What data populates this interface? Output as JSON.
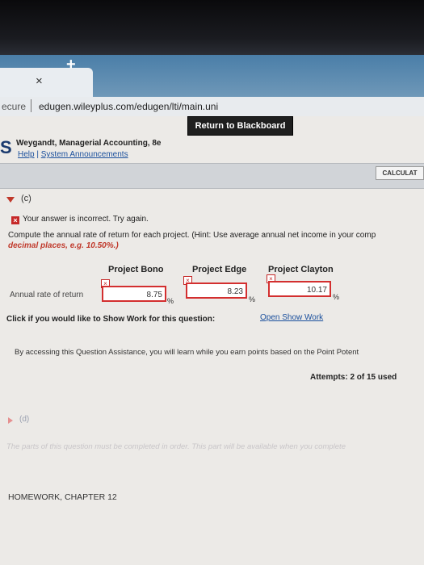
{
  "browser": {
    "tab_close_glyph": "×",
    "new_tab_glyph": "+",
    "security_label": "ecure",
    "url": "edugen.wileyplus.com/edugen/lti/main.uni"
  },
  "header": {
    "return_button": "Return to Blackboard",
    "logo_letter": "S",
    "course_title": "Weygandt, Managerial Accounting, 8e",
    "help_link": "Help",
    "links_separator": "|",
    "announcements_link": "System Announcements",
    "calculator_button": "CALCULAT"
  },
  "part_c": {
    "label": "(c)",
    "error_glyph": "×",
    "status": "Your answer is incorrect.  Try again.",
    "question": "Compute the annual rate of return for each project. (Hint: Use average annual net income in your comp",
    "hint": "decimal places, e.g. 10.50%.)",
    "columns": [
      "Project Bono",
      "Project Edge",
      "Project Clayton"
    ],
    "row_label": "Annual rate of return",
    "answers": [
      "8.75",
      "8.23",
      "10.17"
    ],
    "percent_sign": "%",
    "show_work_prompt": "Click if you would like to Show Work for this question:",
    "show_work_link": "Open Show Work",
    "assistance_text": "By accessing this Question Assistance, you will learn while you earn points based on the Point Potent",
    "attempts": "Attempts: 2 of 15 used"
  },
  "part_d": {
    "label": "(d)",
    "note": "The parts of this question must be completed in order. This part will be available when you complete"
  },
  "footer": {
    "section_title": "HOMEWORK, CHAPTER 12"
  }
}
